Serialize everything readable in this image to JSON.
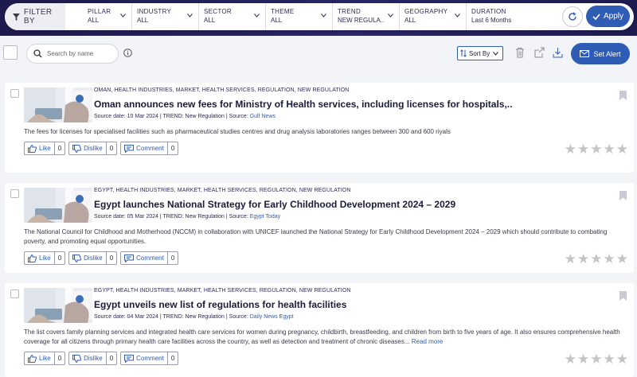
{
  "filters": {
    "filter_by_label": "FILTER BY",
    "columns": [
      {
        "label": "PILLAR",
        "value": "ALL"
      },
      {
        "label": "INDUSTRY",
        "value": "ALL"
      },
      {
        "label": "SECTOR",
        "value": "ALL"
      },
      {
        "label": "THEME",
        "value": "ALL"
      },
      {
        "label": "TREND",
        "value": "NEW REGULA..."
      },
      {
        "label": "GEOGRAPHY",
        "value": "ALL"
      },
      {
        "label": "DURATION",
        "value": "Last 6 Months"
      }
    ],
    "apply_label": "Apply"
  },
  "toolbar": {
    "search_placeholder": "Search by name",
    "sort_label": "Sort By",
    "set_alert_label": "Set Alert"
  },
  "articles": [
    {
      "tags": "OMAN, HEALTH INDUSTRIES, MARKET, HEALTH SERVICES, REGULATION, NEW REGULATION",
      "title": "Oman announces new fees for Ministry of Health services, including licenses for hospitals,..",
      "source_prefix": "Source date: 10 Mar 2024 | TREND: New Regulation | Source: ",
      "source_name": "Gulf News",
      "summary": "The fees for licenses for specialised facilities such as pharmaceutical studies centres and drug analysis laboratories ranges between 300 and 600 riyals",
      "read_more": "",
      "like_label": "Like",
      "like_count": "0",
      "dislike_label": "Dislike",
      "dislike_count": "0",
      "comment_label": "Comment",
      "comment_count": "0",
      "rating": 0
    },
    {
      "tags": "EGYPT, HEALTH INDUSTRIES, MARKET, HEALTH SERVICES, REGULATION, NEW REGULATION",
      "title": "Egypt launches National Strategy for Early Childhood Development 2024 – 2029",
      "source_prefix": "Source date: 05 Mar 2024 | TREND: New Regulation | Source: ",
      "source_name": "Egypt Today",
      "summary": "The National Council for Childhood and Motherhood (NCCM) in collaboration with UNICEF launched the National Strategy for Early Childhood Development 2024 – 2029 which should contribute to combating poverty, and promoting equal opportunities.",
      "read_more": "",
      "like_label": "Like",
      "like_count": "0",
      "dislike_label": "Dislike",
      "dislike_count": "0",
      "comment_label": "Comment",
      "comment_count": "0",
      "rating": 0
    },
    {
      "tags": "EGYPT, HEALTH INDUSTRIES, MARKET, HEALTH SERVICES, REGULATION, NEW REGULATION",
      "title": "Egypt unveils new list of regulations for health facilities",
      "source_prefix": "Source date: 04 Mar 2024 | TREND: New Regulation | Source: ",
      "source_name": "Daily News Egypt",
      "summary": "The list covers family planning services and integrated health care services for women during pregnancy, childbirth, breastfeeding, and children from birth to five years of age. It also ensures comprehensive health coverage for all citizens through primary health care facilities across the country, as well as detection and treatment of chronic diseases...",
      "read_more": "Read more",
      "like_label": "Like",
      "like_count": "0",
      "dislike_label": "Dislike",
      "dislike_count": "0",
      "comment_label": "Comment",
      "comment_count": "0",
      "rating": 0
    }
  ],
  "colors": {
    "accent": "#2f5cb4",
    "header_bg": "#1d1a4d",
    "page_bg": "#f3f4f8"
  }
}
